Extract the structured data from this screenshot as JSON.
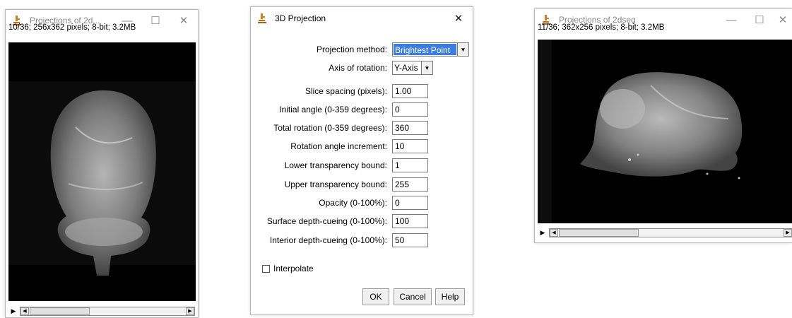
{
  "left_window": {
    "title": "Projections of 2d...",
    "info": "10/36; 256x362 pixels; 8-bit; 3.2MB"
  },
  "dialog": {
    "title": "3D Projection",
    "projection_method": {
      "label": "Projection method:",
      "value": "Brightest Point"
    },
    "axis_of_rotation": {
      "label": "Axis of rotation:",
      "value": "Y-Axis"
    },
    "fields": [
      {
        "label": "Slice spacing (pixels):",
        "value": "1.00"
      },
      {
        "label": "Initial angle (0-359 degrees):",
        "value": "0"
      },
      {
        "label": "Total rotation (0-359 degrees):",
        "value": "360"
      },
      {
        "label": "Rotation angle increment:",
        "value": "10"
      },
      {
        "label": "Lower transparency bound:",
        "value": "1"
      },
      {
        "label": "Upper transparency bound:",
        "value": "255"
      },
      {
        "label": "Opacity (0-100%):",
        "value": "0"
      },
      {
        "label": "Surface depth-cueing (0-100%):",
        "value": "100"
      },
      {
        "label": "Interior depth-cueing (0-100%):",
        "value": "50"
      }
    ],
    "interpolate": {
      "label": "Interpolate",
      "checked": false
    },
    "buttons": {
      "ok": "OK",
      "cancel": "Cancel",
      "help": "Help"
    }
  },
  "right_window": {
    "title": "Projections of 2dseq",
    "info": "11/36; 362x256 pixels; 8-bit; 3.2MB"
  },
  "icons": {
    "minimize": "minimize-icon",
    "maximize": "maximize-icon",
    "close": "close-icon",
    "app": "imagej-microscope-icon",
    "play": "play-icon"
  },
  "window_controls": {
    "minimize": "—",
    "maximize": "☐",
    "close": "✕"
  },
  "colors": {
    "selection": "#3a7fe0",
    "canvas": "#000000"
  }
}
